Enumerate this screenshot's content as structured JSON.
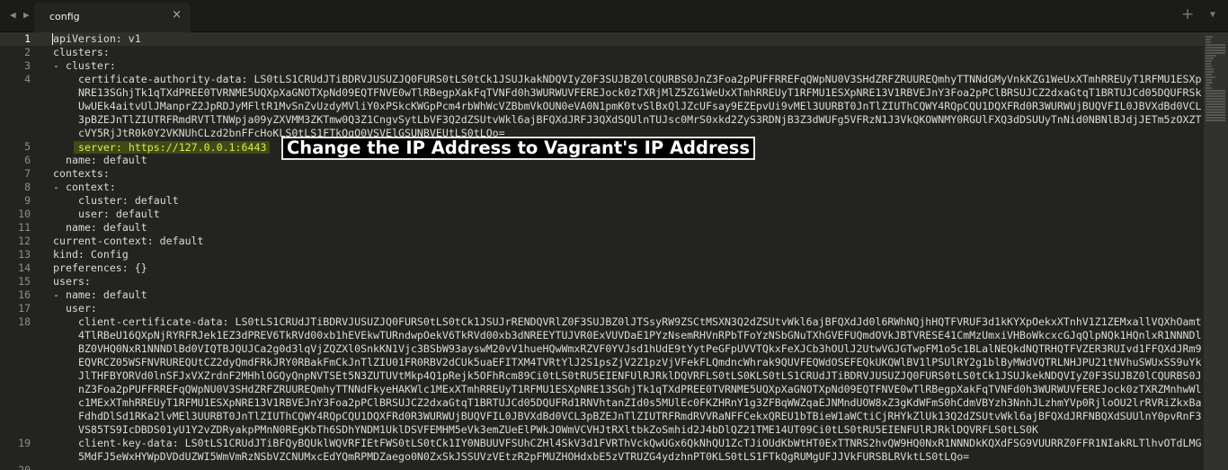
{
  "tabbar": {
    "nav_left_icon": "triangle-left-icon",
    "nav_right_icon": "triangle-right-icon",
    "tab_title": "config",
    "tab_close": "×",
    "new_tab": "+",
    "dropdown_icon": "chevron-down-icon"
  },
  "editor": {
    "lines": {
      "l1": {
        "num": "1",
        "text": "apiVersion: v1"
      },
      "l2": {
        "num": "2",
        "text": "clusters:"
      },
      "l3": {
        "num": "3",
        "text": "- cluster:"
      },
      "l4": {
        "num": "4",
        "text": "certificate-authority-data: LS0tLS1CRUdJTiBDRVJUSUZJQ0FURS0tLS0tCk1JSUJkakNDQVIyZ0F3SUJBZ0lCQURBS0JnZ3Foa2pPUFFRREFqQWpNU0V3SHdZRFZRUUREQmhyTTNNdGMyVnkKZG1WeUxXTmhRREUyT1RFMU1ESXpNRE13SGhjTk1qTXdPREE0TVRNME5UQXpXaGNOTXpNd09EQTFNVE0wTlRBegpXakFqTVNFd0h3WURWUVFEREJock0zTXRjMlZ5ZG1WeUxXTmhRREUyT1RFMU1ESXpNRE13V1RBVEJnY3Foa2pPClBRSUJCZ2dxaGtqT1BRTUJCd05DQUFRSkUwUEk4aitvUlJManprZ2JpRDJyMFltR1MvSnZvUzdyMVliY0xPSkcKWGpPcm4rbWhWcVZBbmVkOUN0eVA0N1pmK0tvSlBxQlJZcUFsay9EZEpvUi9vMEl3UURBT0JnTlZIUThCQWY4RQpCQU1DQXFRd0R3WURWUjBUQVFIL0JBVXdBd0VCL3pBZEJnTlZIUTRFRmdRVTlTNWpja09yZXVMM3ZKTmw0Q3Z1CngvSytLbVF3Q2dZSUtvWkl6ajBFQXdJRFJ3QXdSQUlnTUJsc0MrS0xkd2ZyS3RDNjB3Z3dWUFg5VFRzN1J3VkQKOWNMY0RGUlFXQ3dDSUUyTnNid0NBNlBJdjJETm5zOXZTcVY5RjJtR0k0Y2VKNUhCLzd2bnFFcHoKLS0tLS1FTkQgQ0VSVElGSUNBVEUtLS0tLQo="
      },
      "l5": {
        "num": "5",
        "key": "server:",
        "value": "https://127.0.0.1:6443"
      },
      "l6": {
        "num": "6",
        "text": "name: default"
      },
      "l7": {
        "num": "7",
        "text": "contexts:"
      },
      "l8": {
        "num": "8",
        "text": "- context:"
      },
      "l9": {
        "num": "9",
        "text": "cluster: default"
      },
      "l10": {
        "num": "10",
        "text": "user: default"
      },
      "l11": {
        "num": "11",
        "text": "name: default"
      },
      "l12": {
        "num": "12",
        "text": "current-context: default"
      },
      "l13": {
        "num": "13",
        "text": "kind: Config"
      },
      "l14": {
        "num": "14",
        "text": "preferences: {}"
      },
      "l15": {
        "num": "15",
        "text": "users:"
      },
      "l16": {
        "num": "16",
        "text": "- name: default"
      },
      "l17": {
        "num": "17",
        "text": "user:"
      },
      "l18": {
        "num": "18",
        "text": "client-certificate-data: LS0tLS1CRUdJTiBDRVJUSUZJQ0FURS0tLS0tCk1JSUJrRENDQVRlZ0F3SUJBZ0lJTSsyRW9ZSCtMSXN3Q2dZSUtvWkl6ajBFQXdJd0l6RWhNQjhHQTFVRUF3d1kKYXpOekxXTnhV1Z1ZEMxallVQXhOamt4TlRBeU16QXpNjRYRFRJek1EZ3dPREV6TkRVd00xb1hEVEkwTURndwpOekV6TkRVd00xb3dNREEYTUJVR0ExVUVDaE1PYzNsemRHVnRPbTFoYzNSbGNuTXhGVEFUQmdOVkJBTVRESE41CmMzUmxiVHBoWkcxcGJqQlpNQk1HQnlxR1NNNDlBZ0VHQ0NxR1NNNDlBd0VIQTBJQUJCa2g0d3lqVjZQZXl0SnkKN1Vjc3BSbW93ayswM20vV1hueHQwWmxRZVF0YVJsd1hUdE9tYytPeGFpUVVTQkxFeXJCb3hOUlJ2UtwVGJGTwpFM1o5c1BLalNEQkdNQTRHQTFVZER3RUIvd1FFQXdJRm9EQVRCZ05WSFNVRUREQUtCZ2dyQmdFRkJRY0RBakFmCkJnTlZIU01FR0RBV2dCUk5uaEFITXM4TVRtYlJ2S1psZjV2Z1pzVjVFekFLQmdncWhrak9QUVFEQWdOSEFEQkUKQWlBV1lPSUlRY2g1blByMWdVQTRLNHJPU21tNVhuSWUxSS9uYkJlTHFBYORVd0lnSFJxVXZrdnF2MHhlOGQyQnpNVTSEt5N3ZUTUVtMkp4Q1pRejk5OFhRcm89Ci0tLS0tRU5EIENFUlRJRklDQVRFLS0tLS0KLS0tLS1CRUdJTiBDRVJUSUZJQ0FURS0tLS0tCk1JSUJkekNDQVIyZ0F3SUJBZ0lCQURBS0JnZ3Foa2pPUFFRREFqQWpNU0V3SHdZRFZRUUREQmhyTTNNdFkyeHAKWlc1MExXTmhRREUyT1RFMU1ESXpNRE13SGhjTk1qTXdPREE0TVRNME5UQXpXaGNOTXpNd09EQTFNVE0wTlRBegpXakFqTVNFd0h3WURWUVFEREJock0zTXRZMnhwWlc1MExXTmhRREUyT1RFMU1ESXpNRE13V1RBVEJnY3Foa2pPClBRSUJCZ2dxaGtqT1BRTUJCd05DQUFRd1RNVhtanZId0s5MUlEc0FKZHRnY1g3ZFBqWWZqaEJNMndUOW8xZ3gKdWFmS0hCdmVBYzh3NnhJLzhmYVp0RjloOU2lrRVRiZkxBaFdhdDlSd1RKa2lvMEl3UURBT0JnTlZIUThCQWY4RQpCQU1DQXFRd0R3WURWUjBUQVFIL0JBVXdBd0VCL3pBZEJnTlZIUTRFRmdRVVRaNFFCekxQREU1bTBieW1aWCtiCjRHYkZlUk13Q2dZSUtvWkl6ajBFQXdJRFNBQXdSUUlnY0pvRnF3VS85TS9IcDBDS01yU1Y2vZDRyakpPMnN0REgKbTh6SDhYNDM1UklDSVFEMHM5eVk3emZUeElPWkJOWmVCVHJtRXltbkZoSmhid2J4bDlQZ21TME14UT09Ci0tLS0tRU5EIENFUlRJRklDQVRFLS0tLS0K"
      },
      "l19": {
        "num": "19",
        "text": "client-key-data: LS0tLS1CRUdJTiBFQyBQUklWQVRFIEtFWS0tLS0tCk1IY0NBUUVFSUhCZHl4SkV3d1FVRThVckQwUGx6QkNhQU1ZcTJiOUdKbWtHT0ExTTNRS2hvQW9HQ0NxR1NNNDkKQXdFSG9VUURRZ0FFR1NIakRLTlhvOTdLMG5MdFJ5eWxHYWpDVDdUZWI5WmVmRzNSbVZCNUMxcEdYQmRPMDZaego0N0ZxSkJSSUVzVEtzR2pFMUZHOHdxbE5zVTRUZG4ydzhnPT0KLS0tLS1FTkQgRUMgUFJJVkFURSBLRVktLS0tLQo="
      },
      "l20": {
        "num": "20",
        "text": ""
      }
    }
  },
  "annotation": {
    "callout_text": "Change the IP Address to Vagrant's IP Address"
  }
}
